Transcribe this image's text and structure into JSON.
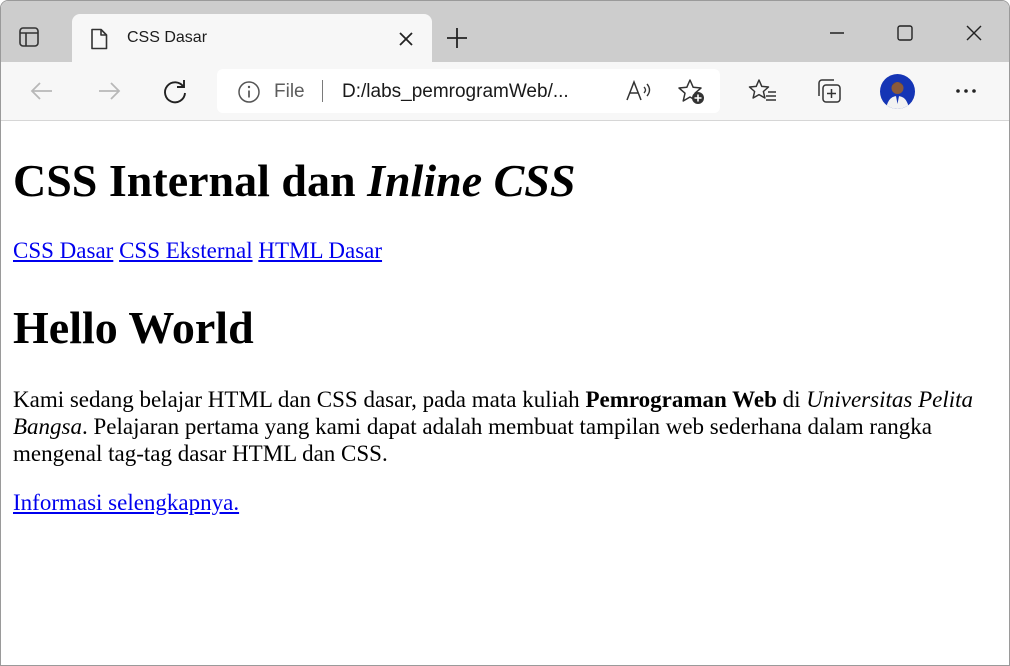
{
  "browser": {
    "tab": {
      "title": "CSS Dasar"
    },
    "address": {
      "scheme_label": "File",
      "url": "D:/labs_pemrogramWeb/..."
    }
  },
  "page": {
    "heading_plain": "CSS Internal dan ",
    "heading_italic": "Inline CSS",
    "nav_links": [
      "CSS Dasar",
      "CSS Eksternal",
      "HTML Dasar"
    ],
    "subheading": "Hello World",
    "paragraph": {
      "part1": "Kami sedang belajar HTML dan CSS dasar, pada mata kuliah ",
      "bold": "Pemrograman Web",
      "part2": " di ",
      "italic": "Universitas Pelita Bangsa",
      "part3": ". Pelajaran pertama yang kami dapat adalah membuat tampilan web sederhana dalam rangka mengenal tag-tag dasar HTML dan CSS."
    },
    "more_link": "Informasi selengkapnya."
  },
  "icons": {
    "tab_actions": "tab-actions-icon",
    "document": "document-icon",
    "close": "close-icon",
    "new_tab": "plus-icon",
    "back": "back-arrow-icon",
    "forward": "forward-arrow-icon",
    "refresh": "refresh-icon",
    "info": "info-icon",
    "read_aloud": "read-aloud-icon",
    "add_favorite": "add-favorite-icon",
    "favorites": "favorites-icon",
    "collections": "collections-icon",
    "more": "more-icon"
  },
  "colors": {
    "link": "#0000ee",
    "tabstrip": "#cdcdcd",
    "toolbar": "#f7f7f7",
    "avatar": "#1535b5"
  }
}
